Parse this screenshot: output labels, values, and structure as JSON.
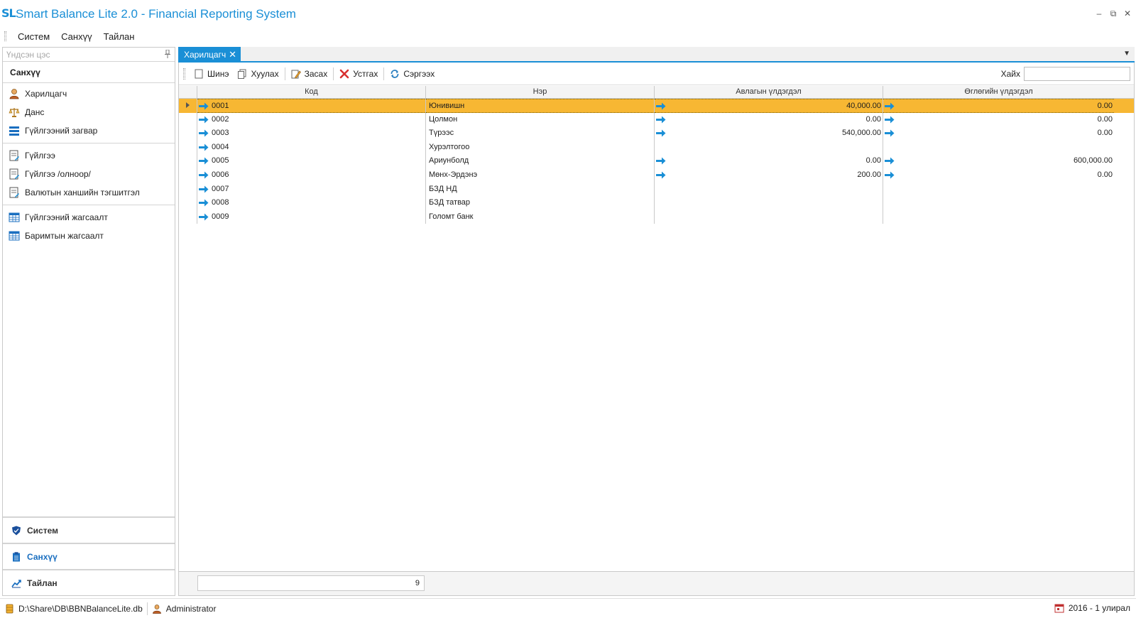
{
  "app": {
    "logo": "SL",
    "title": "Smart Balance Lite 2.0 - Financial Reporting System"
  },
  "window_controls": {
    "minimize": "–",
    "restore": "⧉",
    "close": "✕"
  },
  "menu": [
    "Систем",
    "Санхүү",
    "Тайлан"
  ],
  "nav": {
    "header": "Үндсэн цэс",
    "group_title": "Санхүү",
    "items": [
      {
        "label": "Харилцагч",
        "icon": "customer-icon"
      },
      {
        "label": "Данс",
        "icon": "scales-icon"
      },
      {
        "label": "Гүйлгээний загвар",
        "icon": "template-icon"
      },
      {
        "label": "Гүйлгээ",
        "icon": "transaction-icon"
      },
      {
        "label": "Гүйлгээ /олноор/",
        "icon": "transaction-bulk-icon"
      },
      {
        "label": "Валютын ханшийн тэгшитгэл",
        "icon": "currency-adjust-icon"
      },
      {
        "label": "Гүйлгээний жагсаалт",
        "icon": "table-icon"
      },
      {
        "label": "Баримтын жагсаалт",
        "icon": "table-icon"
      }
    ],
    "bottom": [
      {
        "label": "Систем",
        "icon": "shield-icon"
      },
      {
        "label": "Санхүү",
        "icon": "clipboard-icon"
      },
      {
        "label": "Тайлан",
        "icon": "chart-icon"
      }
    ]
  },
  "tab": {
    "label": "Харилцагч",
    "close": "✕"
  },
  "toolbar": {
    "new": "Шинэ",
    "copy": "Хуулах",
    "edit": "Засах",
    "delete": "Устгах",
    "refresh": "Сэргээх",
    "search_label": "Хайх",
    "search_value": ""
  },
  "grid": {
    "columns": [
      "Код",
      "Нэр",
      "Авлагын үлдэгдэл",
      "Өглөгийн үлдэгдэл"
    ],
    "rows": [
      {
        "code": "0001",
        "name": "Юнивишн",
        "debit": "40,000.00",
        "credit": "0.00",
        "selected": true
      },
      {
        "code": "0002",
        "name": "Цолмон",
        "debit": "0.00",
        "credit": "0.00"
      },
      {
        "code": "0003",
        "name": "Түрээс",
        "debit": "540,000.00",
        "credit": "0.00"
      },
      {
        "code": "0004",
        "name": "Хурэлтогоо",
        "debit": "",
        "credit": ""
      },
      {
        "code": "0005",
        "name": "Ариунболд",
        "debit": "0.00",
        "credit": "600,000.00"
      },
      {
        "code": "0006",
        "name": "Мөнх-Эрдэнэ",
        "debit": "200.00",
        "credit": "0.00"
      },
      {
        "code": "0007",
        "name": "БЗД НД",
        "debit": "",
        "credit": ""
      },
      {
        "code": "0008",
        "name": "БЗД татвар",
        "debit": "",
        "credit": ""
      },
      {
        "code": "0009",
        "name": "Голомт банк",
        "debit": "",
        "credit": ""
      }
    ],
    "footer_count": "9"
  },
  "status": {
    "db_path": "D:\\Share\\DB\\BBNBalanceLite.db",
    "user": "Administrator",
    "period": "2016 - 1 улирал"
  },
  "colors": {
    "accent": "#1a8fd6",
    "selected_row": "#f7b733",
    "arrow": "#1a8fd6"
  }
}
